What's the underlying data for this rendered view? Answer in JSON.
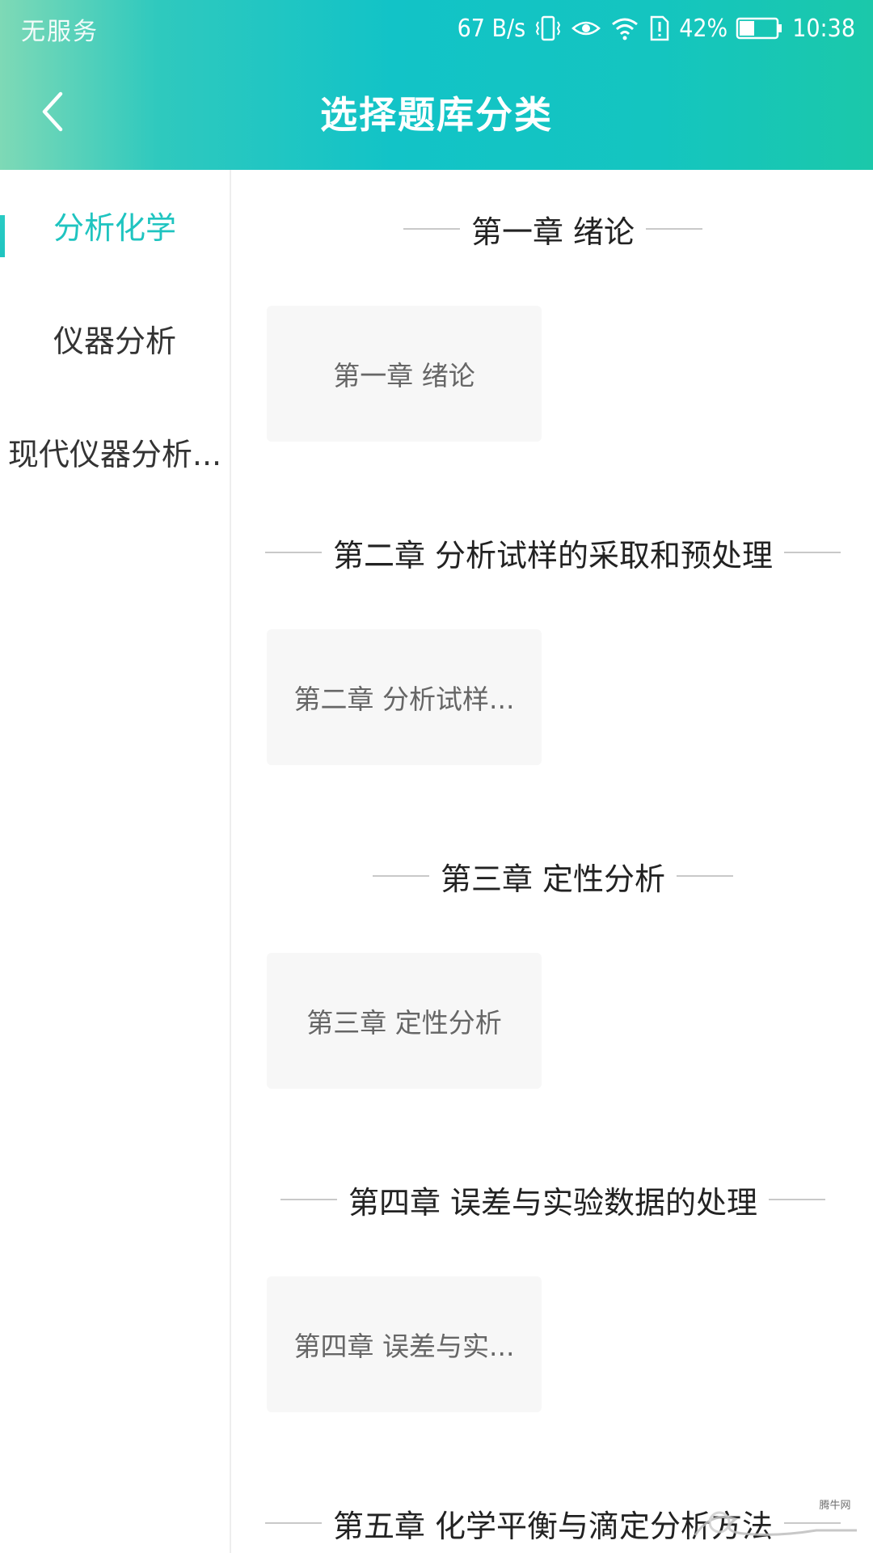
{
  "status_bar": {
    "carrier": "无服务",
    "net_speed": "67 B/s",
    "battery_percent": "42%",
    "time": "10:38",
    "icons": [
      "vibrate-icon",
      "eye-icon",
      "wifi-icon",
      "sim-alert-icon",
      "battery-icon"
    ],
    "battery_level": 0.42
  },
  "header": {
    "title": "选择题库分类",
    "back_icon": "chevron-left-icon"
  },
  "sidebar": {
    "items": [
      {
        "label": "分析化学",
        "active": true
      },
      {
        "label": "仪器分析",
        "active": false
      },
      {
        "label": "现代仪器分析...",
        "active": false
      }
    ]
  },
  "content": {
    "sections": [
      {
        "heading": "第一章 绪论",
        "cards": [
          "第一章 绪论"
        ]
      },
      {
        "heading": "第二章 分析试样的采取和预处理",
        "cards": [
          "第二章 分析试样..."
        ]
      },
      {
        "heading": "第三章 定性分析",
        "cards": [
          "第三章 定性分析"
        ]
      },
      {
        "heading": "第四章 误差与实验数据的处理",
        "cards": [
          "第四章 误差与实..."
        ]
      },
      {
        "heading": "第五章 化学平衡与滴定分析方法",
        "cards": []
      }
    ]
  },
  "watermark": {
    "text": "腾牛网"
  },
  "colors": {
    "accent": "#1fc4c0",
    "header_gradient_start": "#7ed9b6",
    "header_gradient_end": "#1bc8aa",
    "card_bg": "#f7f7f7"
  }
}
